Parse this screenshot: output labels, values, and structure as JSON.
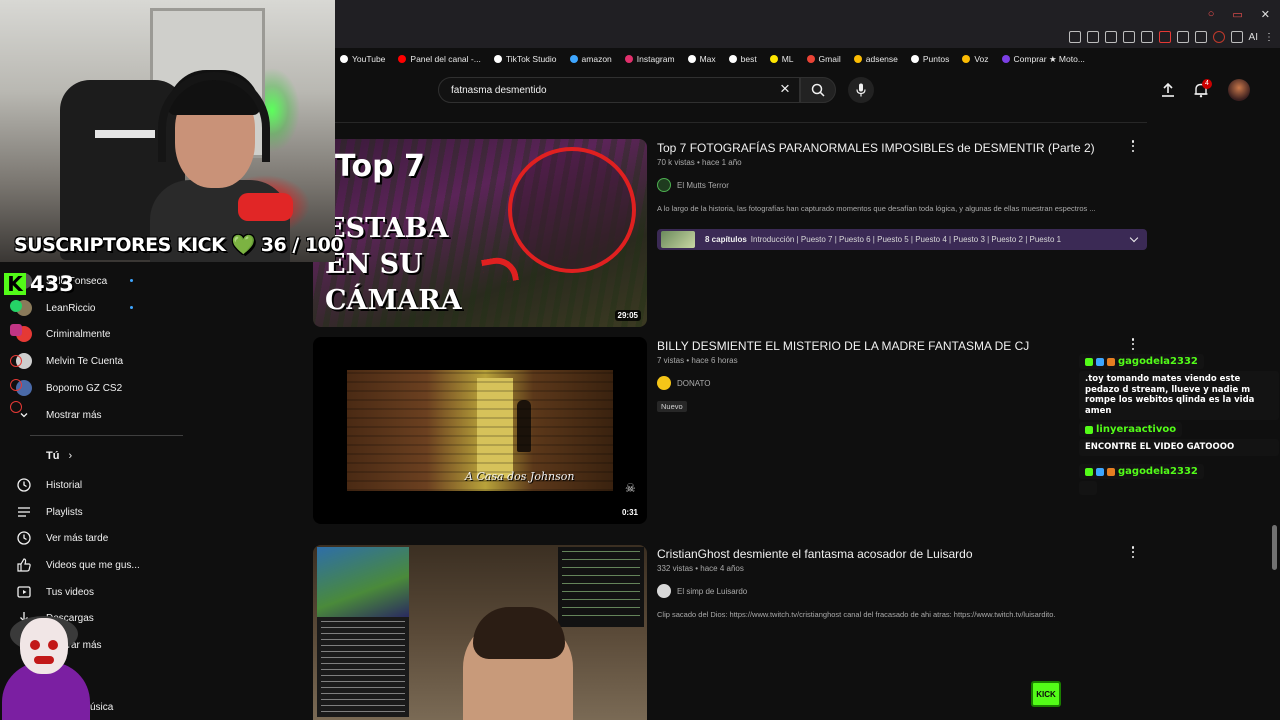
{
  "browser": {
    "bookmarks": [
      {
        "label": "YouTube",
        "color": "#ffffff"
      },
      {
        "label": "Panel del canal -...",
        "color": "#ff0000"
      },
      {
        "label": "TikTok Studio",
        "color": "#ffffff"
      },
      {
        "label": "amazon",
        "color": "#3ea6ff"
      },
      {
        "label": "Instagram",
        "color": "#e1306c"
      },
      {
        "label": "Max",
        "color": "#ffffff"
      },
      {
        "label": "best",
        "color": "#ffffff"
      },
      {
        "label": "ML",
        "color": "#ffe600"
      },
      {
        "label": "Gmail",
        "color": "#ea4335"
      },
      {
        "label": "adsense",
        "color": "#fbbc04"
      },
      {
        "label": "Puntos",
        "color": "#ffffff"
      },
      {
        "label": "Voz",
        "color": "#fbbc04"
      },
      {
        "label": "Comprar ★ Moto...",
        "color": "#7b3fe4"
      }
    ],
    "ext_ai": "AI"
  },
  "youtube": {
    "search_query": "fatnasma desmentido",
    "notification_count": "4"
  },
  "overlay": {
    "subs_label": "SUSCRIPTORES KICK",
    "subs_heart": "💚",
    "subs_count": "36 / 100",
    "kick_logo": "K",
    "kick_viewers": "433",
    "kick_button": "KICK"
  },
  "sidebar": {
    "subscriptions": [
      {
        "label": "Solo Fonseca",
        "color": "#555555",
        "live_dot": true
      },
      {
        "label": "LeanRiccio",
        "color": "#8a7a5a",
        "live_dot": true
      },
      {
        "label": "Criminalmente",
        "color": "#e53935",
        "live_dot": false
      },
      {
        "label": "Melvin Te Cuenta",
        "color": "#cfcfcf",
        "live_dot": false
      },
      {
        "label": "Bopomo GZ CS2",
        "color": "#4a6aa8",
        "live_dot": false
      }
    ],
    "show_more": "Mostrar más",
    "you_section": "Tú",
    "you_items": [
      {
        "label": "Historial",
        "icon": "history-icon"
      },
      {
        "label": "Playlists",
        "icon": "playlists-icon"
      },
      {
        "label": "Ver más tarde",
        "icon": "watch-later-icon"
      },
      {
        "label": "Videos que me gus...",
        "icon": "like-icon"
      },
      {
        "label": "Tus videos",
        "icon": "your-videos-icon"
      },
      {
        "label": "Descargas",
        "icon": "downloads-icon"
      },
      {
        "label": "Mostrar más",
        "icon": "chevron-down-icon"
      }
    ],
    "music_partial": "úsica"
  },
  "videos": [
    {
      "title": "Top 7 FOTOGRAFÍAS PARANORMALES IMPOSIBLES de DESMENTIR (Parte 2)",
      "meta": "70 k vistas • hace 1 año",
      "channel": "El Mutts Terror",
      "description": "A lo largo de la historia, las fotografías han capturado momentos que desafían toda lógica, y algunas de ellas muestran espectros ...",
      "duration": "29:05",
      "thumb_text_top": "Top 7",
      "thumb_text_main": [
        "ESTABA",
        "EN SU",
        "CÁMARA"
      ],
      "chapters_count": "8 capítulos",
      "chapters_list": "Introducción | Puesto 7 | Puesto 6 | Puesto 5 | Puesto 4 | Puesto 3 | Puesto 2 | Puesto 1"
    },
    {
      "title": "BILLY DESMIENTE EL MISTERIO DE LA MADRE FANTASMA DE CJ",
      "meta": "7 vistas • hace 6 horas",
      "channel": "DONATO",
      "badge": "Nuevo",
      "duration": "0:31",
      "thumb_caption": "A Casa dos Johnson"
    },
    {
      "title": "CristianGhost desmiente el fantasma acosador de Luisardo",
      "meta": "332 vistas • hace 4 años",
      "channel": "El simp de Luisardo",
      "description": "Clip sacado del Dios: https://www.twitch.tv/cristianghost canal del fracasado de ahi atras: https://www.twitch.tv/luisardito."
    }
  ],
  "chat": [
    {
      "user": "gagodela2332",
      "message": ".toy tomando mates viendo este pedazo d stream, llueve y nadie m rompe los webitos qlinda es la vida amen"
    },
    {
      "user": "linyeraactivoo",
      "message": "ENCONTRE EL VIDEO GATOOOO"
    },
    {
      "user": "gagodela2332",
      "message": ""
    }
  ]
}
